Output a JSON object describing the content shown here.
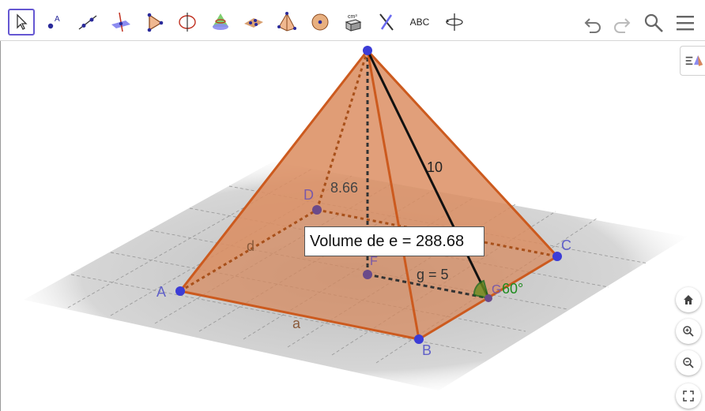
{
  "toolbar": {
    "tools": [
      {
        "name": "move-tool",
        "icon": "pointer-icon"
      },
      {
        "name": "point-tool",
        "icon": "point-icon",
        "text": "A"
      },
      {
        "name": "line-tool",
        "icon": "line-icon"
      },
      {
        "name": "perpendicular-tool",
        "icon": "perpendicular-icon"
      },
      {
        "name": "polygon-tool",
        "icon": "polygon-icon"
      },
      {
        "name": "circle-axis-tool",
        "icon": "circle-axis-icon"
      },
      {
        "name": "intersect-surfaces-tool",
        "icon": "intersect-icon"
      },
      {
        "name": "plane-tool",
        "icon": "plane-icon"
      },
      {
        "name": "pyramid-tool",
        "icon": "pyramid-icon"
      },
      {
        "name": "sphere-tool",
        "icon": "sphere-icon"
      },
      {
        "name": "volume-tool",
        "icon": "volume-icon",
        "text": "cm³"
      },
      {
        "name": "reflect-tool",
        "icon": "reflect-icon"
      },
      {
        "name": "text-tool",
        "icon": "text-icon",
        "text": "ABC"
      },
      {
        "name": "rotate-view-tool",
        "icon": "rotate-view-icon"
      }
    ],
    "undo_icon": "undo-icon",
    "redo_icon": "redo-icon",
    "search_icon": "search-icon",
    "menu_icon": "menu-icon"
  },
  "labels": {
    "apex_height": "8.66",
    "edge": "10",
    "point_a": "A",
    "point_b": "B",
    "point_c": "C",
    "point_d": "D",
    "point_f": "F",
    "segment_a": "a",
    "segment_d": "d",
    "segment_g": "g = 5",
    "angle": "60°",
    "point_g_label": "G"
  },
  "volume_text": "Volume de e = 288.68",
  "colors": {
    "pyramid_fill": "#d9875a",
    "pyramid_edge": "#cc5a1e",
    "point": "#3c3cd6",
    "angle": "#1e8c1e",
    "active_tool": "#6557d2"
  },
  "side": {
    "panel_toggle_icon": "algebra-panel-icon",
    "home_icon": "home-icon",
    "zoom_in_icon": "zoom-in-icon",
    "zoom_out_icon": "zoom-out-icon",
    "fullscreen_icon": "fullscreen-icon"
  }
}
